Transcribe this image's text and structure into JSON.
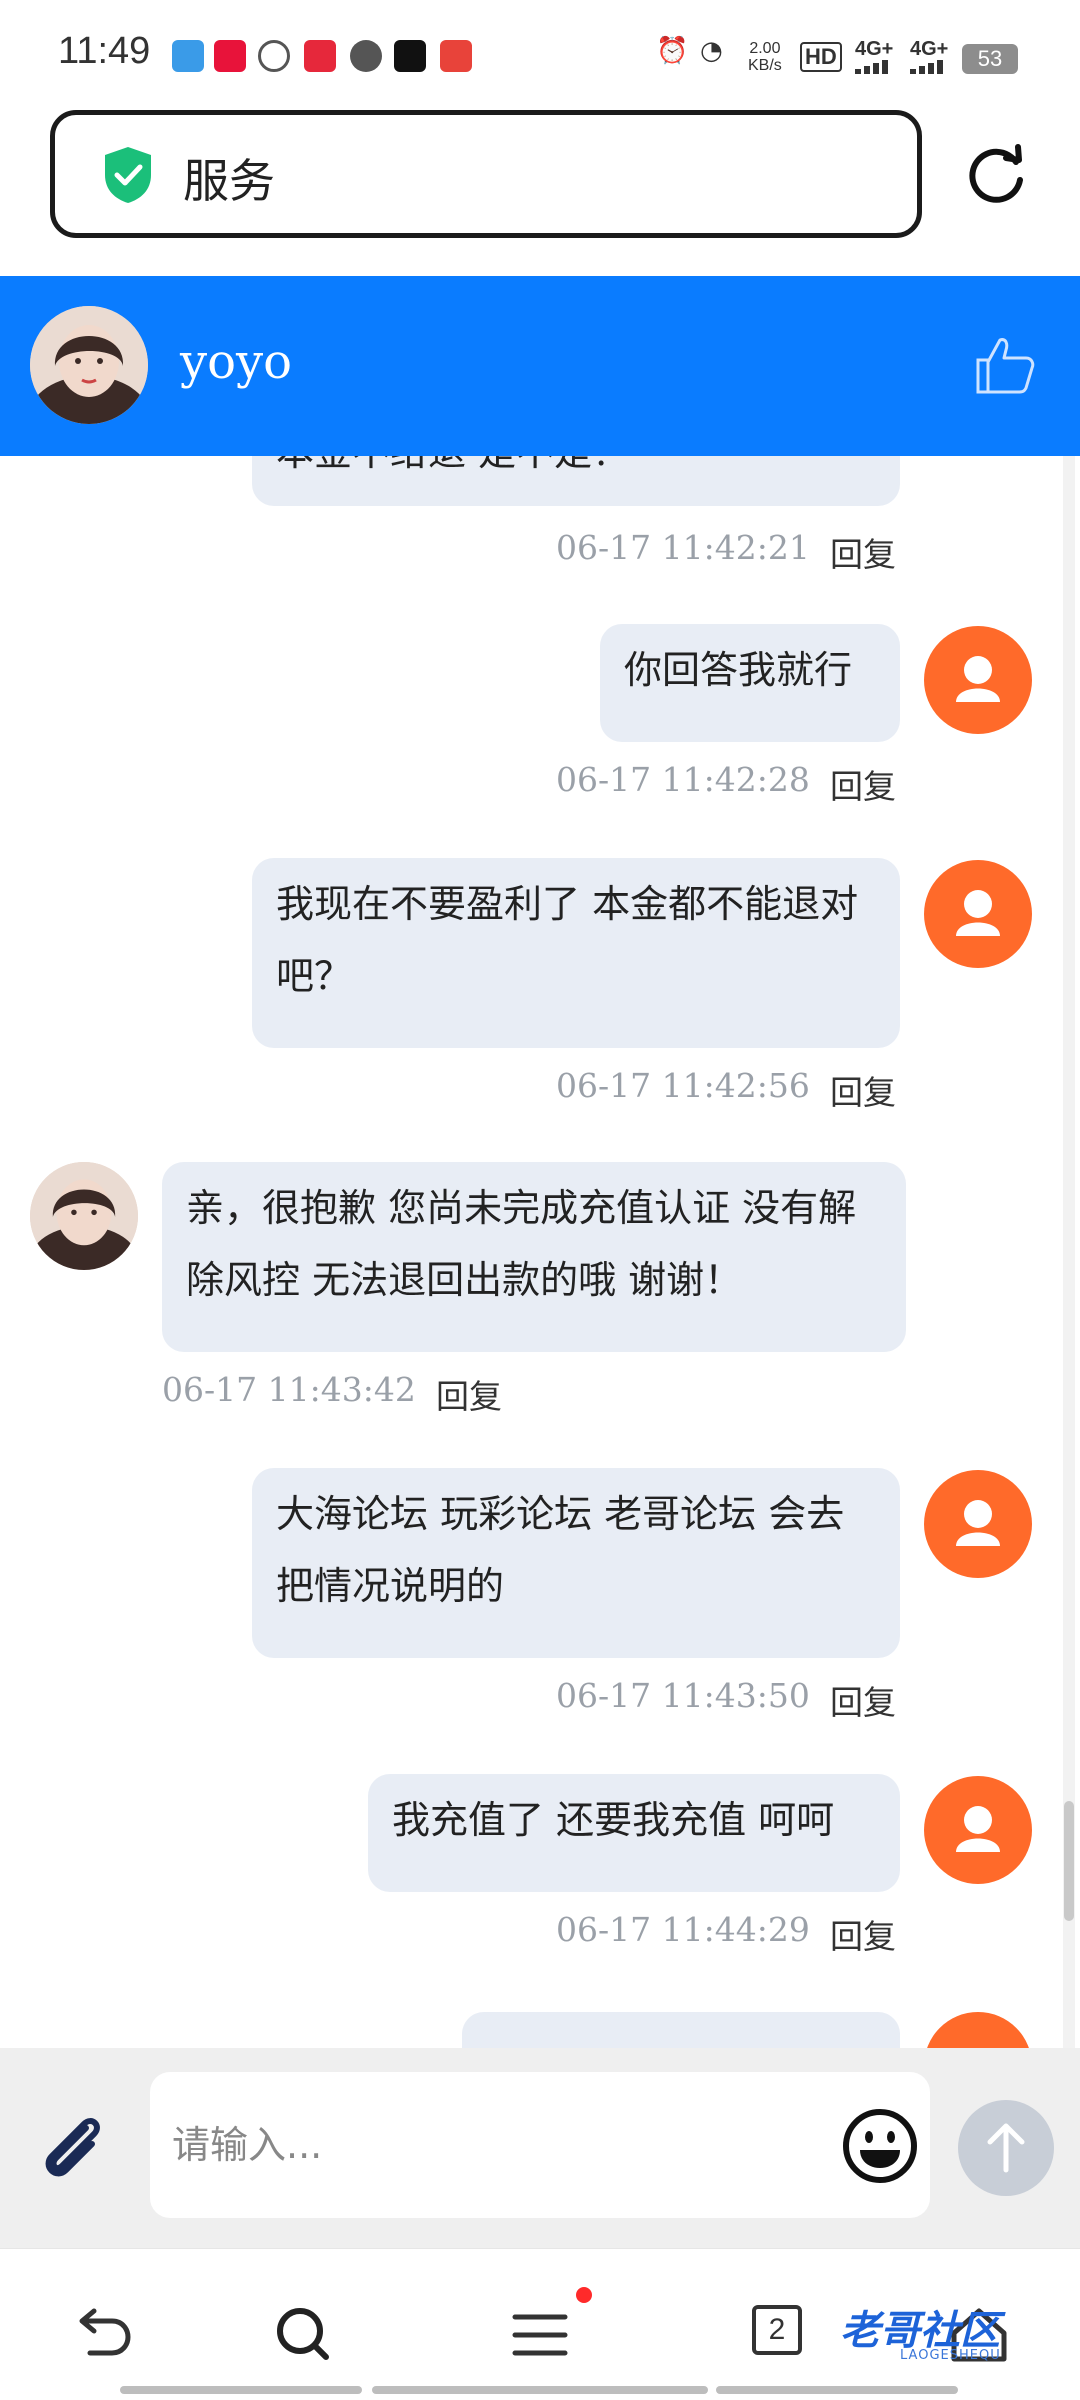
{
  "status_bar": {
    "time": "11:49",
    "speed_value": "2.00",
    "speed_unit": "KB/s",
    "battery": "53",
    "network_labels": [
      "4G+",
      "4G+"
    ],
    "hd_label": "HD"
  },
  "browser": {
    "page_title": "服务"
  },
  "chat_header": {
    "name": "yoyo"
  },
  "messages": {
    "partial_top_text": "本金不给退 是不是？",
    "m1_time": "06-17 11:42:21",
    "m2_text": "你回答我就行",
    "m2_time": "06-17 11:42:28",
    "m3_text": "我现在不要盈利了 本金都不能退对吧？",
    "m3_time": "06-17 11:42:56",
    "m4_text": "亲，很抱歉 您尚未完成充值认证 没有解除风控 无法退回出款的哦 谢谢！",
    "m4_time": "06-17 11:43:42",
    "m5_text": "大海论坛 玩彩论坛 老哥论坛 会去把情况说明的",
    "m5_time": "06-17 11:43:50",
    "m6_text": "我充值了 还要我充值 呵呵",
    "m6_time": "06-17 11:44:29",
    "reply_label": "回复"
  },
  "input": {
    "placeholder": "请输入..."
  },
  "nav": {
    "tab_count": "2"
  },
  "watermark": {
    "text": "老哥社区",
    "sub": "LAOGESHEQU"
  },
  "colors": {
    "header_blue": "#0a7cff",
    "user_avatar_orange": "#ff6a2a",
    "bubble_bg": "#e8edf5",
    "shield_green": "#1bbf7a"
  }
}
